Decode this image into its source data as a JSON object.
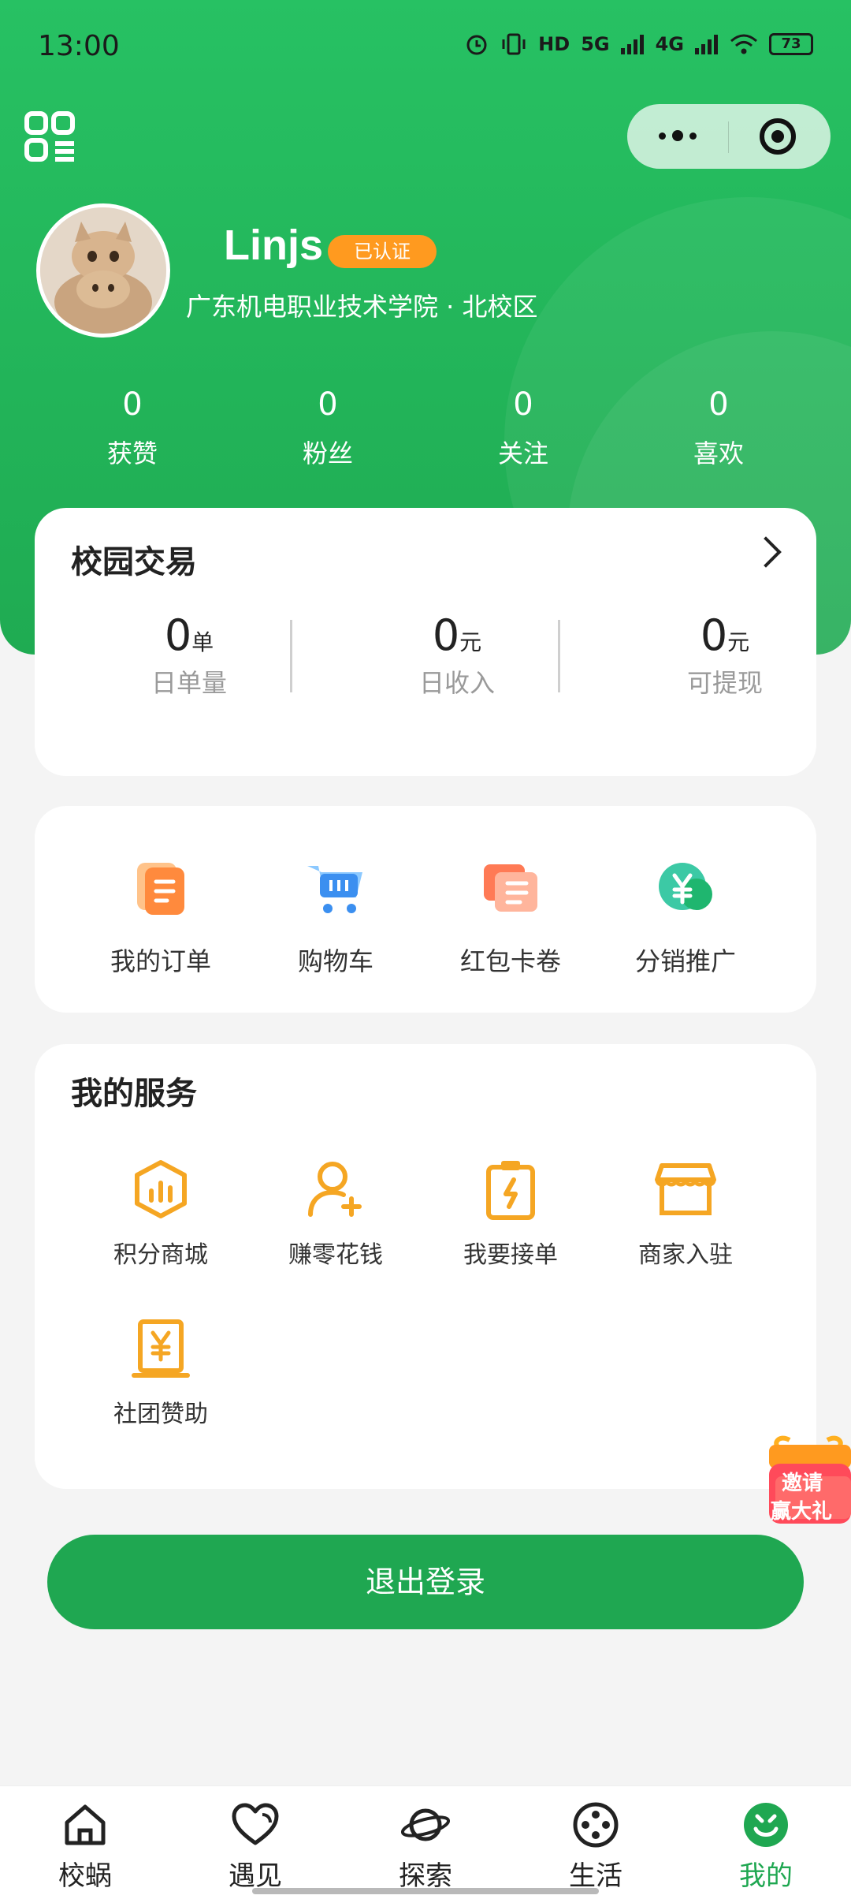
{
  "status_bar": {
    "time": "13:00",
    "network_a": "5G",
    "network_b": "4G",
    "hd": "HD",
    "battery": "73"
  },
  "profile": {
    "name": "Linjs",
    "badge": "已认证",
    "school": "广东机电职业技术学院 · 北校区"
  },
  "stats": [
    {
      "value": "0",
      "label": "获赞"
    },
    {
      "value": "0",
      "label": "粉丝"
    },
    {
      "value": "0",
      "label": "关注"
    },
    {
      "value": "0",
      "label": "喜欢"
    }
  ],
  "trade": {
    "title": "校园交易",
    "items": [
      {
        "value": "0",
        "unit": "单",
        "label": "日单量"
      },
      {
        "value": "0",
        "unit": "元",
        "label": "日收入"
      },
      {
        "value": "0",
        "unit": "元",
        "label": "可提现"
      }
    ]
  },
  "quick": [
    {
      "label": "我的订单",
      "icon": "order-icon"
    },
    {
      "label": "购物车",
      "icon": "cart-icon"
    },
    {
      "label": "红包卡卷",
      "icon": "coupon-icon"
    },
    {
      "label": "分销推广",
      "icon": "yuan-icon"
    }
  ],
  "services": {
    "title": "我的服务",
    "items": [
      {
        "label": "积分商城",
        "icon": "points-mall-icon"
      },
      {
        "label": "赚零花钱",
        "icon": "user-add-icon"
      },
      {
        "label": "我要接单",
        "icon": "clipboard-bolt-icon"
      },
      {
        "label": "商家入驻",
        "icon": "shop-icon"
      },
      {
        "label": "社团赞助",
        "icon": "sponsor-icon"
      }
    ]
  },
  "logout_label": "退出登录",
  "float_gift": {
    "line1": "邀请",
    "line2": "赢大礼"
  },
  "tabs": [
    {
      "label": "校蜗",
      "icon": "home-icon"
    },
    {
      "label": "遇见",
      "icon": "heart-icon"
    },
    {
      "label": "探索",
      "icon": "planet-icon"
    },
    {
      "label": "生活",
      "icon": "film-reel-icon"
    },
    {
      "label": "我的",
      "icon": "smile-icon",
      "active": true
    }
  ],
  "colors": {
    "brand": "#1fa751",
    "badge": "#ff9a1f",
    "service_icon": "#f5a623"
  }
}
